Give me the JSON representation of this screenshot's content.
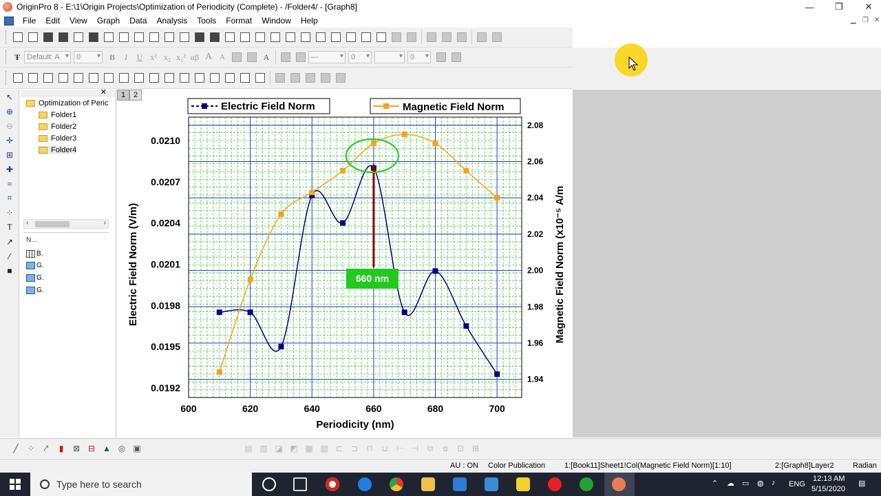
{
  "window": {
    "title": "OriginPro 8 - E:\\1\\Origin Projects\\Optimization of Periodicity (Complete) - /Folder4/ - [Graph8]",
    "controls": [
      "—",
      "❐",
      "✕"
    ]
  },
  "menu": {
    "items": [
      "File",
      "Edit",
      "View",
      "Graph",
      "Data",
      "Analysis",
      "Tools",
      "Format",
      "Window",
      "Help"
    ]
  },
  "format_toolbar": {
    "font": "Default: A",
    "font_size": "0",
    "line_width": "0",
    "pattern_size": "0",
    "bold": "B",
    "italic": "I",
    "underline": "U",
    "superscript": "x²",
    "subscript": "x₂",
    "sup_sub": "x₁²",
    "greek": "αβ",
    "enlarge": "A",
    "reduce": "A"
  },
  "explorer": {
    "root": "Optimization of Peric",
    "folders": [
      "Folder1",
      "Folder2",
      "Folder3",
      "Folder4"
    ],
    "list_header": "N...",
    "list_items": [
      "B.",
      "G.",
      "G.",
      "G."
    ]
  },
  "layer_tabs": [
    "1",
    "2"
  ],
  "chart_data": {
    "type": "line",
    "x": [
      610,
      620,
      630,
      640,
      650,
      660,
      670,
      680,
      690,
      700
    ],
    "series": [
      {
        "name": "Electric Field Norm",
        "color": "#000080",
        "axis": "left",
        "values": [
          0.01975,
          0.01975,
          0.0195,
          0.0206,
          0.0204,
          0.0208,
          0.01975,
          0.02005,
          0.01965,
          0.0193
        ]
      },
      {
        "name": "Magnetic Field Norm",
        "color": "#f7a21b",
        "axis": "right",
        "values": [
          1.944,
          1.995,
          2.031,
          2.043,
          2.055,
          2.07,
          2.075,
          2.07,
          2.055,
          2.04
        ]
      }
    ],
    "xlabel": "Periodicity (nm)",
    "ylabel": "Electric Field Norm (V/m)",
    "y2label": "Magnetic Field Norm (x10⁻⁵ A/m",
    "xlim": [
      600,
      708
    ],
    "ylim": [
      0.01913,
      0.02117
    ],
    "y2lim": [
      1.93,
      2.0845
    ],
    "xticks": [
      "600",
      "620",
      "640",
      "660",
      "680",
      "700"
    ],
    "yticks": [
      "0.0192",
      "0.0195",
      "0.0198",
      "0.0201",
      "0.0204",
      "0.0207",
      "0.0210"
    ],
    "y2ticks": [
      "1.94",
      "1.96",
      "1.98",
      "2.00",
      "2.02",
      "2.04",
      "2.06",
      "2.08"
    ],
    "grid": true,
    "legend": "top",
    "annotation": {
      "text": "660 nm",
      "x": 660,
      "color": "#22c91f"
    },
    "marker_line_color": "#8b0000",
    "highlight_color": "#22c91f"
  },
  "statusbar": {
    "au": "AU : ON",
    "mode": "Color Publication",
    "column": "1:[Book11]Sheet1!Col(Magnetic Field Norm)[1:10]",
    "layer": "2:[Graph8]Layer2",
    "angle": "Radian"
  },
  "taskbar": {
    "search_placeholder": "Type here to search",
    "lang": "ENG",
    "time": "12:13 AM",
    "date": "5/15/2020"
  }
}
